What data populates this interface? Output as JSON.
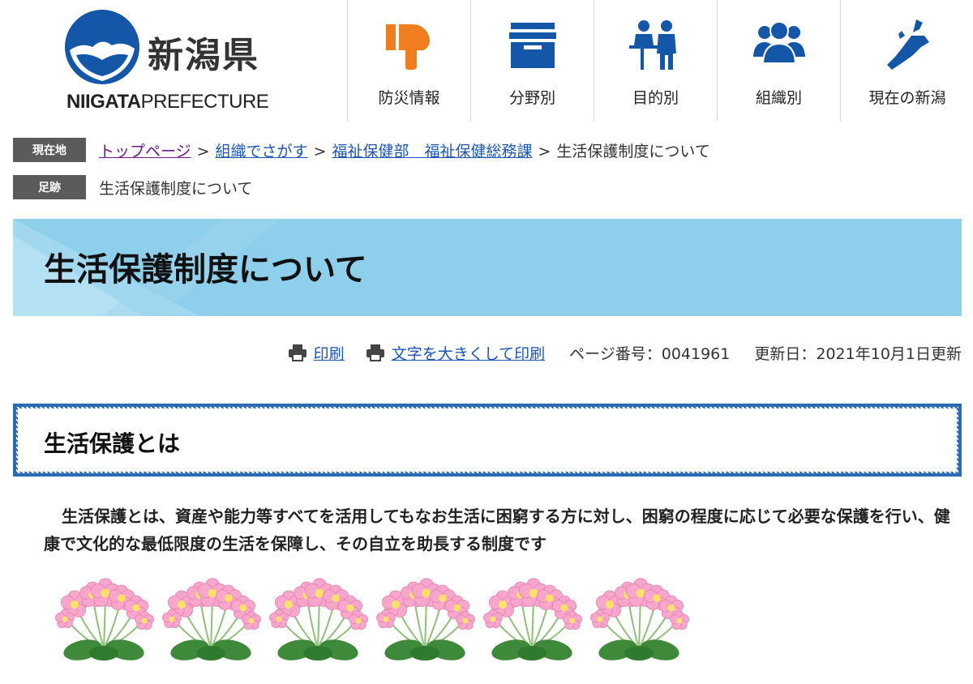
{
  "header": {
    "logo_kanji": "新潟県",
    "logo_en_bold": "NIIGATA",
    "logo_en_rest": "PREFECTURE",
    "colors": {
      "brand_blue": "#1456a8"
    }
  },
  "nav": {
    "items": [
      {
        "label": "防災情報",
        "icon": "megaphone-icon",
        "color": "#f07d1e"
      },
      {
        "label": "分野別",
        "icon": "file-box-icon",
        "color": "#1456a8"
      },
      {
        "label": "目的別",
        "icon": "people-counter-icon",
        "color": "#1456a8"
      },
      {
        "label": "組織別",
        "icon": "group-icon",
        "color": "#1456a8"
      },
      {
        "label": "現在の新潟",
        "icon": "niigata-map-icon",
        "color": "#1456a8"
      }
    ]
  },
  "breadcrumb": {
    "current_label": "現在地",
    "links": [
      "トップページ",
      "組織でさがす",
      "福祉保健部　福祉保健総務課"
    ],
    "separator": ">",
    "current_page": "生活保護制度について"
  },
  "footprint": {
    "label": "足跡",
    "item": "生活保護制度について"
  },
  "page": {
    "title": "生活保護制度について",
    "banner_color": "#8ecfeb"
  },
  "tools": {
    "print": "印刷",
    "print_large": "文字を大きくして印刷",
    "page_number": "ページ番号：0041961",
    "updated": "更新日：2021年10月1日更新"
  },
  "section": {
    "title": "生活保護とは",
    "body": "生活保護とは、資産や能力等すべてを活用してもなお生活に困窮する方に対し、困窮の程度に応じて必要な保護を行い、健康で文化的な最低限度の生活を保障し、その自立を助長する制度です",
    "border_color": "#2a6cb2"
  },
  "decoration": {
    "flower_icon": "pink-flower-icon",
    "count": 6
  }
}
